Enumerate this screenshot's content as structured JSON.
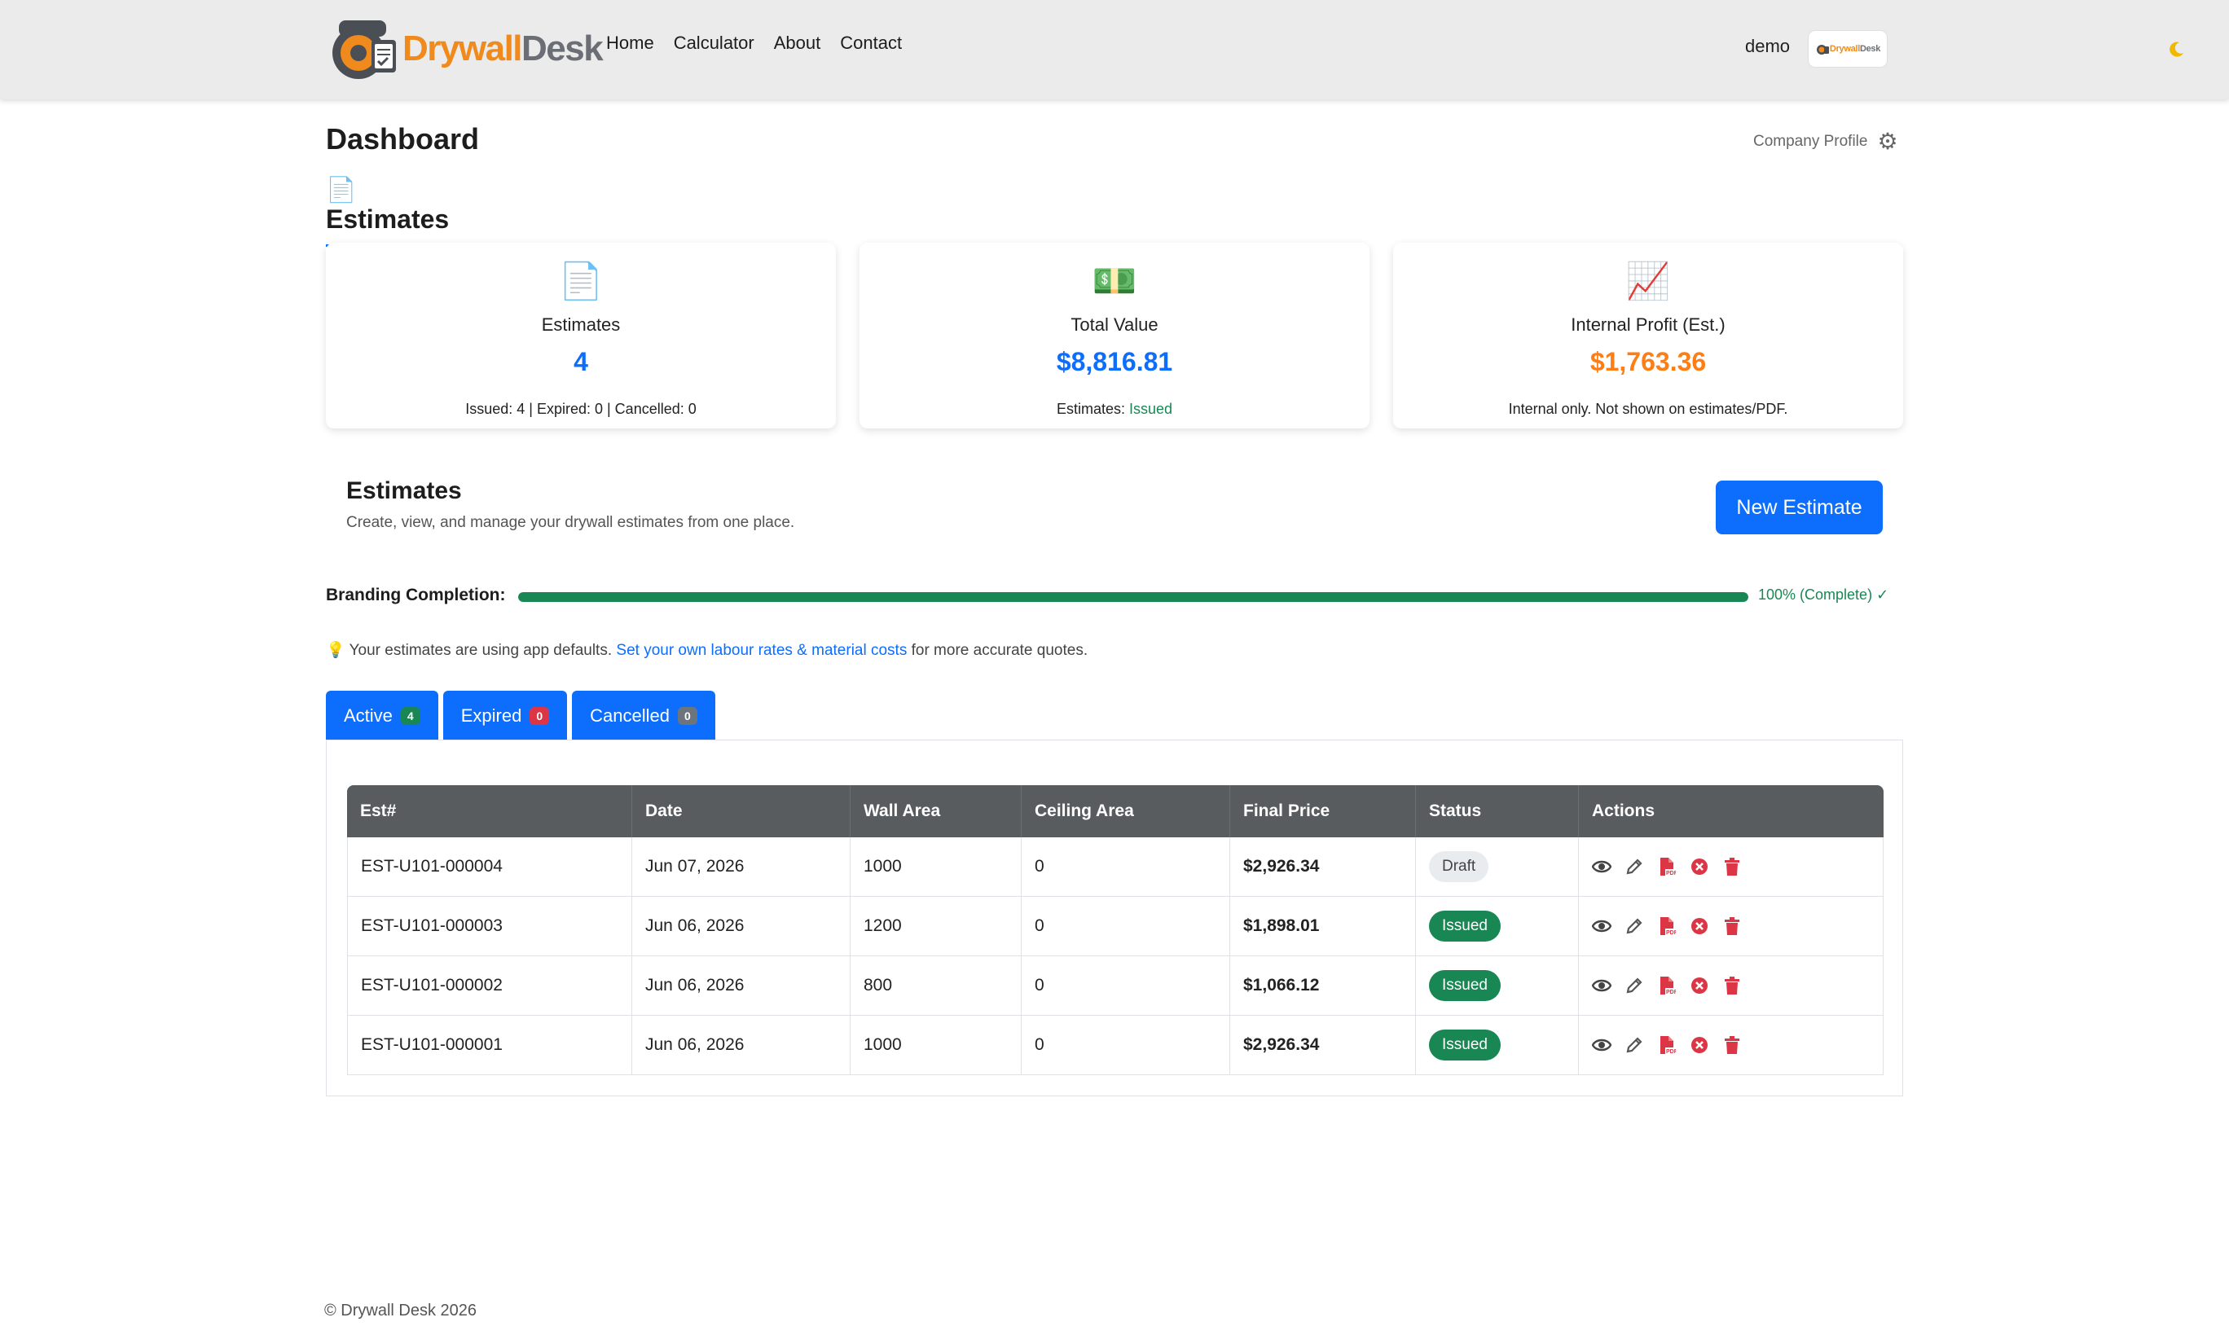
{
  "navbar": {
    "brand_a": "Drywall",
    "brand_b": "Desk",
    "links": [
      "Home",
      "Calculator",
      "About",
      "Contact"
    ],
    "user": "demo",
    "avatar_logo_a": "Drywall",
    "avatar_logo_b": "Desk",
    "theme_icon": "moon-icon"
  },
  "header": {
    "title": "Dashboard",
    "company_profile": "Company Profile",
    "section_tab": "Estimates"
  },
  "cards": [
    {
      "icon": "document-icon",
      "title": "Estimates",
      "value": "4",
      "sub": "Issued: 4 | Expired: 0 | Cancelled: 0"
    },
    {
      "icon": "money-icon",
      "title": "Total Value",
      "value": "$8,816.81",
      "sub_prefix": "Estimates:",
      "sub_status": "Issued"
    },
    {
      "icon": "chart-up-icon",
      "title": "Internal Profit (Est.)",
      "value": "$1,763.36",
      "sub": "Internal only. Not shown on estimates/PDF."
    }
  ],
  "estimates": {
    "title": "Estimates",
    "subtitle": "Create, view, and manage your drywall estimates from one place.",
    "new_button": "New Estimate"
  },
  "branding": {
    "label": "Branding Completion:",
    "percent": 100,
    "text": "100% (Complete) ✓"
  },
  "tip": {
    "prefix": "Your estimates are using app defaults.",
    "link": "Set your own labour rates & material costs",
    "suffix": "for more accurate quotes."
  },
  "tabs": [
    {
      "label": "Active",
      "count": "4"
    },
    {
      "label": "Expired",
      "count": "0"
    },
    {
      "label": "Cancelled",
      "count": "0"
    }
  ],
  "table": {
    "headers": [
      "Est#",
      "Date",
      "Wall Area",
      "Ceiling Area",
      "Final Price",
      "Status",
      "Actions"
    ],
    "rows": [
      {
        "est": "EST-U101-000004",
        "date": "Jun 07, 2026",
        "wall": "1000",
        "ceiling": "0",
        "price": "$2,926.34",
        "status": "Draft"
      },
      {
        "est": "EST-U101-000003",
        "date": "Jun 06, 2026",
        "wall": "1200",
        "ceiling": "0",
        "price": "$1,898.01",
        "status": "Issued"
      },
      {
        "est": "EST-U101-000002",
        "date": "Jun 06, 2026",
        "wall": "800",
        "ceiling": "0",
        "price": "$1,066.12",
        "status": "Issued"
      },
      {
        "est": "EST-U101-000001",
        "date": "Jun 06, 2026",
        "wall": "1000",
        "ceiling": "0",
        "price": "$2,926.34",
        "status": "Issued"
      }
    ]
  },
  "footer": "© Drywall Desk 2026",
  "colors": {
    "primary": "#0d6efd",
    "success": "#198754",
    "danger": "#dc3545",
    "profit": "#fd7e14",
    "brand_orange": "#f08a1c"
  }
}
